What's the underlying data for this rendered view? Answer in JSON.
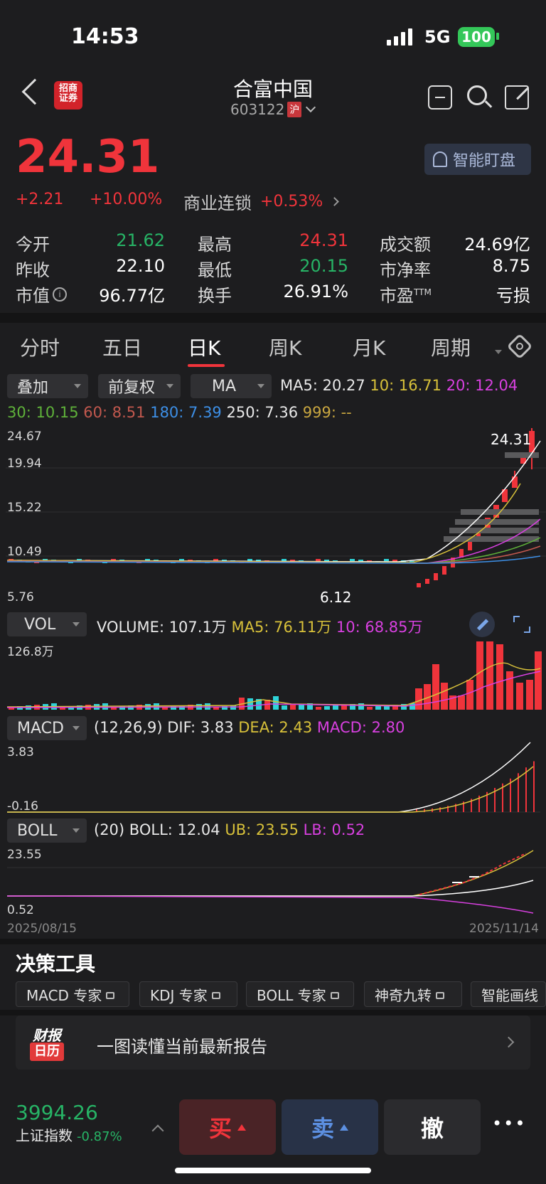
{
  "status_bar": {
    "time": "14:53",
    "network": "5G",
    "battery": "100"
  },
  "header": {
    "broker_logo_text": "招商证券",
    "stock_name": "合富中国",
    "stock_code": "603122",
    "market_badge": "沪"
  },
  "quote": {
    "price": "24.31",
    "change": "+2.21",
    "change_pct": "+10.00%",
    "sector": "商业连锁",
    "sector_change": "+0.53%",
    "watch_button": "智能盯盘"
  },
  "stats": {
    "open_label": "今开",
    "open": "21.62",
    "high_label": "最高",
    "high": "24.31",
    "turnover_amount_label": "成交额",
    "turnover_amount": "24.69亿",
    "prev_close_label": "昨收",
    "prev_close": "22.10",
    "low_label": "最低",
    "low": "20.15",
    "pb_label": "市净率",
    "pb": "8.75",
    "market_cap_label": "市值",
    "market_cap": "96.77亿",
    "turnover_rate_label": "换手",
    "turnover_rate": "26.91%",
    "pe_label": "市盈",
    "pe_sup": "TTM",
    "pe": "亏损"
  },
  "tabs": [
    "分时",
    "五日",
    "日K",
    "周K",
    "月K",
    "周期"
  ],
  "active_tab": "日K",
  "kline_controls": {
    "overlay": "叠加",
    "adjust": "前复权",
    "indicator": "MA"
  },
  "ma_legend": {
    "ma5": "MA5: 20.27",
    "ma10": "10: 16.71",
    "ma20": "20: 12.04",
    "ma30": "30: 10.15",
    "ma60": "60: 8.51",
    "ma180": "180: 7.39",
    "ma250": "250: 7.36",
    "ma999": "999: --"
  },
  "price_axis": [
    "24.67",
    "19.94",
    "15.22",
    "10.49",
    "5.76"
  ],
  "price_annotations": {
    "high": "24.31",
    "low": "6.12"
  },
  "vol": {
    "label": "VOL",
    "volume": "VOLUME: 107.1万",
    "ma5": "MA5: 76.11万",
    "ma10": "10: 68.85万",
    "axis_max": "126.8万"
  },
  "macd": {
    "label": "MACD",
    "params": "(12,26,9)",
    "dif": "DIF: 3.83",
    "dea": "DEA: 2.43",
    "macd": "MACD: 2.80",
    "axis_max": "3.83",
    "axis_min": "-0.16"
  },
  "boll": {
    "label": "BOLL",
    "params": "(20)",
    "mid": "BOLL: 12.04",
    "ub": "UB: 23.55",
    "lb": "LB: 0.52",
    "axis_max": "23.55",
    "axis_min": "0.52"
  },
  "dates": {
    "start": "2025/08/15",
    "end": "2025/11/14"
  },
  "tools": {
    "title": "决策工具",
    "items": [
      "MACD 专家",
      "KDJ 专家",
      "BOLL 专家",
      "神奇九转",
      "智能画线"
    ]
  },
  "report": {
    "badge_top": "财报",
    "badge_bottom": "日历",
    "text": "一图读懂当前最新报告"
  },
  "bottom": {
    "index_value": "3994.26",
    "index_name": "上证指数",
    "index_change": "-0.87%",
    "buy": "买",
    "sell": "卖",
    "cancel": "撤",
    "more": "•••"
  },
  "colors": {
    "up": "#f0343b",
    "down": "#27b466",
    "bg": "#1d1d1f",
    "ma5": "#ffffff",
    "ma10": "#d8c13a",
    "ma20": "#d840e0"
  }
}
